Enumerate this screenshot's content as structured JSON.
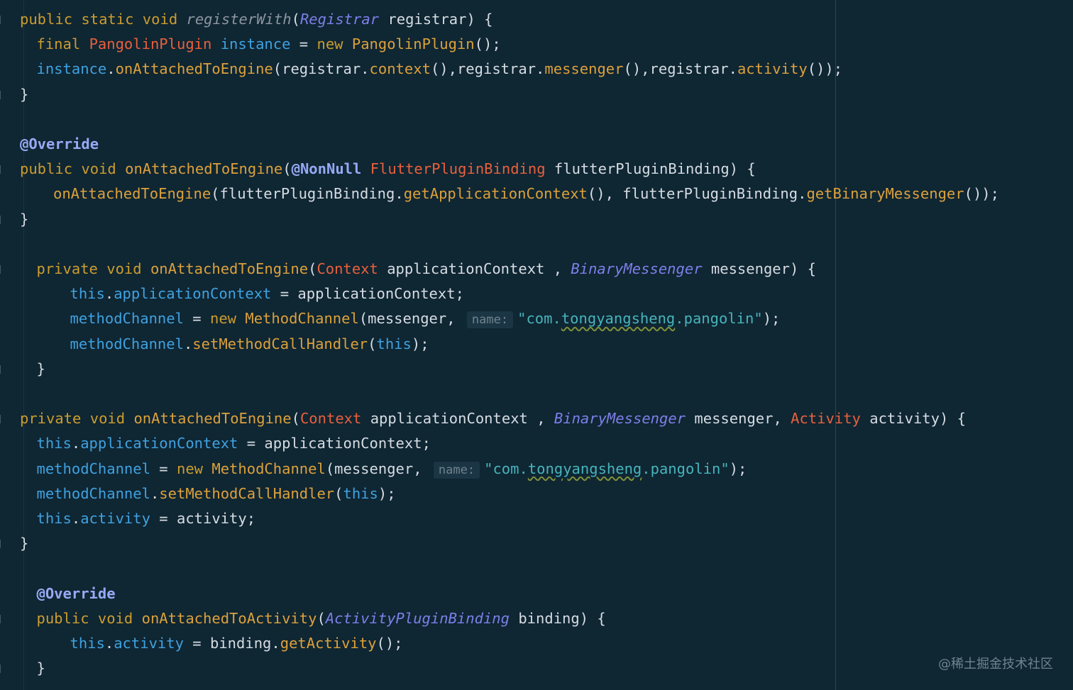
{
  "editor": {
    "colors": {
      "background": "#0f2633",
      "keyword": "#cc9d2e",
      "type": "#e8603c",
      "italic_type": "#7d7fe8",
      "method": "#dca13b",
      "field": "#3fa2e0",
      "annotation": "#97a9f4",
      "string": "#47b4bb",
      "text": "#d6dce2"
    },
    "lines": [
      {
        "indent": 1,
        "fold": true,
        "tokens": [
          {
            "t": "public static void ",
            "c": "kw"
          },
          {
            "t": "registerWith",
            "c": "ifn"
          },
          {
            "t": "(",
            "c": "txt"
          },
          {
            "t": "Registrar",
            "c": "itype"
          },
          {
            "t": " registrar) {",
            "c": "txt"
          }
        ]
      },
      {
        "indent": 2,
        "fold": false,
        "tokens": [
          {
            "t": "final ",
            "c": "kw"
          },
          {
            "t": "PangolinPlugin ",
            "c": "type"
          },
          {
            "t": "instance",
            "c": "fld"
          },
          {
            "t": " = ",
            "c": "txt"
          },
          {
            "t": "new ",
            "c": "kw"
          },
          {
            "t": "PangolinPlugin",
            "c": "fn"
          },
          {
            "t": "();",
            "c": "txt"
          }
        ]
      },
      {
        "indent": 2,
        "fold": false,
        "tokens": [
          {
            "t": "instance",
            "c": "fld"
          },
          {
            "t": ".",
            "c": "txt"
          },
          {
            "t": "onAttachedToEngine",
            "c": "fn"
          },
          {
            "t": "(registrar.",
            "c": "txt"
          },
          {
            "t": "context",
            "c": "fn"
          },
          {
            "t": "(),registrar.",
            "c": "txt"
          },
          {
            "t": "messenger",
            "c": "fn"
          },
          {
            "t": "(),registrar.",
            "c": "txt"
          },
          {
            "t": "activity",
            "c": "fn"
          },
          {
            "t": "());",
            "c": "txt"
          }
        ]
      },
      {
        "indent": 1,
        "fold": true,
        "tokens": [
          {
            "t": "}",
            "c": "txt"
          }
        ]
      },
      {
        "indent": 1,
        "fold": false,
        "tokens": []
      },
      {
        "indent": 1,
        "fold": false,
        "tokens": [
          {
            "t": "@Override",
            "c": "ann"
          }
        ]
      },
      {
        "indent": 1,
        "fold": true,
        "tokens": [
          {
            "t": "public void ",
            "c": "kw"
          },
          {
            "t": "onAttachedToEngine",
            "c": "fn"
          },
          {
            "t": "(",
            "c": "txt"
          },
          {
            "t": "@NonNull ",
            "c": "ann"
          },
          {
            "t": "FlutterPluginBinding",
            "c": "type"
          },
          {
            "t": " flutterPluginBinding) {",
            "c": "txt"
          }
        ]
      },
      {
        "indent": 3,
        "fold": false,
        "tokens": [
          {
            "t": "onAttachedToEngine",
            "c": "fn"
          },
          {
            "t": "(flutterPluginBinding.",
            "c": "txt"
          },
          {
            "t": "getApplicationContext",
            "c": "fn"
          },
          {
            "t": "(), flutterPluginBinding.",
            "c": "txt"
          },
          {
            "t": "getBinaryMessenger",
            "c": "fn"
          },
          {
            "t": "());",
            "c": "txt"
          }
        ]
      },
      {
        "indent": 1,
        "fold": true,
        "tokens": [
          {
            "t": "}",
            "c": "txt"
          }
        ]
      },
      {
        "indent": 1,
        "fold": false,
        "tokens": []
      },
      {
        "indent": 2,
        "fold": true,
        "tokens": [
          {
            "t": "private void ",
            "c": "kw"
          },
          {
            "t": "onAttachedToEngine",
            "c": "fn"
          },
          {
            "t": "(",
            "c": "txt"
          },
          {
            "t": "Context",
            "c": "type"
          },
          {
            "t": " applicationContext , ",
            "c": "txt"
          },
          {
            "t": "BinaryMessenger",
            "c": "itype"
          },
          {
            "t": " messenger) {",
            "c": "txt"
          }
        ]
      },
      {
        "indent": 4,
        "fold": false,
        "tokens": [
          {
            "t": "this",
            "c": "fld"
          },
          {
            "t": ".",
            "c": "txt"
          },
          {
            "t": "applicationContext",
            "c": "fld"
          },
          {
            "t": " = applicationContext;",
            "c": "txt"
          }
        ]
      },
      {
        "indent": 4,
        "fold": false,
        "tokens": [
          {
            "t": "methodChannel",
            "c": "fld"
          },
          {
            "t": " = ",
            "c": "txt"
          },
          {
            "t": "new ",
            "c": "kw"
          },
          {
            "t": "MethodChannel",
            "c": "fn"
          },
          {
            "t": "(messenger, ",
            "c": "txt"
          },
          {
            "t": "name:",
            "c": "hint"
          },
          {
            "t": "\"com.",
            "c": "str"
          },
          {
            "t": "tongyangsheng",
            "c": "str sq"
          },
          {
            "t": ".pangolin\"",
            "c": "str"
          },
          {
            "t": ");",
            "c": "txt"
          }
        ]
      },
      {
        "indent": 4,
        "fold": false,
        "tokens": [
          {
            "t": "methodChannel",
            "c": "fld"
          },
          {
            "t": ".",
            "c": "txt"
          },
          {
            "t": "setMethodCallHandler",
            "c": "fn"
          },
          {
            "t": "(",
            "c": "txt"
          },
          {
            "t": "this",
            "c": "fld"
          },
          {
            "t": ");",
            "c": "txt"
          }
        ]
      },
      {
        "indent": 2,
        "fold": true,
        "tokens": [
          {
            "t": "}",
            "c": "txt"
          }
        ]
      },
      {
        "indent": 1,
        "fold": false,
        "tokens": []
      },
      {
        "indent": 1,
        "fold": true,
        "tokens": [
          {
            "t": "private void ",
            "c": "kw"
          },
          {
            "t": "onAttachedToEngine",
            "c": "fn"
          },
          {
            "t": "(",
            "c": "txt"
          },
          {
            "t": "Context",
            "c": "type"
          },
          {
            "t": " applicationContext , ",
            "c": "txt"
          },
          {
            "t": "BinaryMessenger",
            "c": "itype"
          },
          {
            "t": " messenger, ",
            "c": "txt"
          },
          {
            "t": "Activity",
            "c": "type"
          },
          {
            "t": " activity) {",
            "c": "txt"
          }
        ]
      },
      {
        "indent": 2,
        "fold": false,
        "tokens": [
          {
            "t": "this",
            "c": "fld"
          },
          {
            "t": ".",
            "c": "txt"
          },
          {
            "t": "applicationContext",
            "c": "fld"
          },
          {
            "t": " = applicationContext;",
            "c": "txt"
          }
        ]
      },
      {
        "indent": 2,
        "fold": false,
        "tokens": [
          {
            "t": "methodChannel",
            "c": "fld"
          },
          {
            "t": " = ",
            "c": "txt"
          },
          {
            "t": "new ",
            "c": "kw"
          },
          {
            "t": "MethodChannel",
            "c": "fn"
          },
          {
            "t": "(messenger, ",
            "c": "txt"
          },
          {
            "t": "name:",
            "c": "hint"
          },
          {
            "t": "\"com.",
            "c": "str"
          },
          {
            "t": "tongyangsheng",
            "c": "str sq"
          },
          {
            "t": ".pangolin\"",
            "c": "str"
          },
          {
            "t": ");",
            "c": "txt"
          }
        ]
      },
      {
        "indent": 2,
        "fold": false,
        "tokens": [
          {
            "t": "methodChannel",
            "c": "fld"
          },
          {
            "t": ".",
            "c": "txt"
          },
          {
            "t": "setMethodCallHandler",
            "c": "fn"
          },
          {
            "t": "(",
            "c": "txt"
          },
          {
            "t": "this",
            "c": "fld"
          },
          {
            "t": ");",
            "c": "txt"
          }
        ]
      },
      {
        "indent": 2,
        "fold": false,
        "tokens": [
          {
            "t": "this",
            "c": "fld"
          },
          {
            "t": ".",
            "c": "txt"
          },
          {
            "t": "activity",
            "c": "fld"
          },
          {
            "t": " = activity;",
            "c": "txt"
          }
        ]
      },
      {
        "indent": 1,
        "fold": true,
        "tokens": [
          {
            "t": "}",
            "c": "txt"
          }
        ]
      },
      {
        "indent": 1,
        "fold": false,
        "tokens": []
      },
      {
        "indent": 2,
        "fold": false,
        "tokens": [
          {
            "t": "@Override",
            "c": "ann"
          }
        ]
      },
      {
        "indent": 2,
        "fold": true,
        "tokens": [
          {
            "t": "public void ",
            "c": "kw"
          },
          {
            "t": "onAttachedToActivity",
            "c": "fn"
          },
          {
            "t": "(",
            "c": "txt"
          },
          {
            "t": "ActivityPluginBinding",
            "c": "itype"
          },
          {
            "t": " binding) {",
            "c": "txt"
          }
        ]
      },
      {
        "indent": 4,
        "fold": false,
        "tokens": [
          {
            "t": "this",
            "c": "fld"
          },
          {
            "t": ".",
            "c": "txt"
          },
          {
            "t": "activity",
            "c": "fld"
          },
          {
            "t": " = binding.",
            "c": "txt"
          },
          {
            "t": "getActivity",
            "c": "fn"
          },
          {
            "t": "();",
            "c": "txt"
          }
        ]
      },
      {
        "indent": 2,
        "fold": true,
        "tokens": [
          {
            "t": "}",
            "c": "txt"
          }
        ]
      }
    ]
  },
  "watermark": "@稀土掘金技术社区"
}
